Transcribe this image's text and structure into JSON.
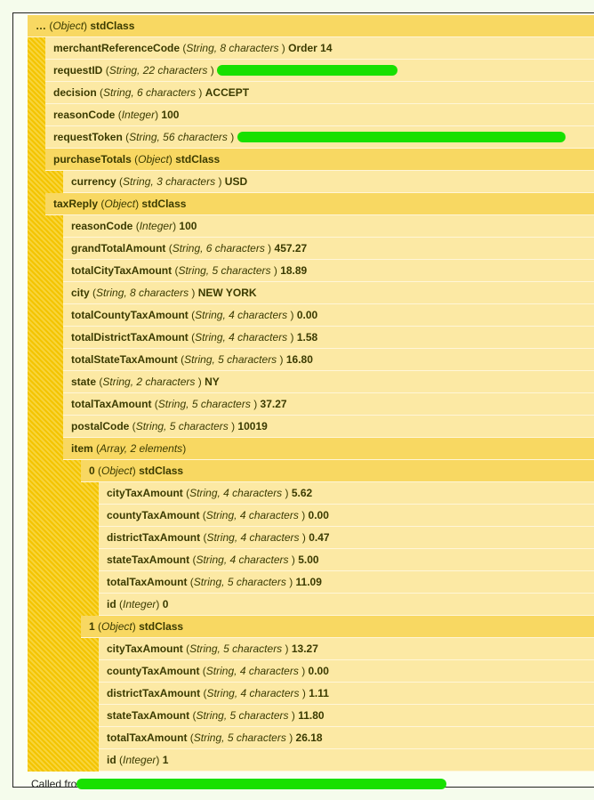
{
  "rows": [
    {
      "d": 0,
      "obj": true,
      "key": "…",
      "type": "Object",
      "value": "stdClass"
    },
    {
      "d": 1,
      "key": "merchantReferenceCode",
      "type": "String, 8 characters ",
      "value": "Order 14"
    },
    {
      "d": 1,
      "key": "requestID",
      "type": "String, 22 characters ",
      "value": "",
      "redacted": 203
    },
    {
      "d": 1,
      "key": "decision",
      "type": "String, 6 characters ",
      "value": "ACCEPT"
    },
    {
      "d": 1,
      "key": "reasonCode",
      "type": "Integer",
      "value": "100"
    },
    {
      "d": 1,
      "key": "requestToken",
      "type": "String, 56 characters ",
      "value": "",
      "redacted": 369
    },
    {
      "d": 1,
      "obj": true,
      "key": "purchaseTotals",
      "type": "Object",
      "value": "stdClass"
    },
    {
      "d": 2,
      "key": "currency",
      "type": "String, 3 characters ",
      "value": "USD"
    },
    {
      "d": 1,
      "obj": true,
      "key": "taxReply",
      "type": "Object",
      "value": "stdClass"
    },
    {
      "d": 2,
      "key": "reasonCode",
      "type": "Integer",
      "value": "100"
    },
    {
      "d": 2,
      "key": "grandTotalAmount",
      "type": "String, 6 characters ",
      "value": "457.27"
    },
    {
      "d": 2,
      "key": "totalCityTaxAmount",
      "type": "String, 5 characters ",
      "value": "18.89"
    },
    {
      "d": 2,
      "key": "city",
      "type": "String, 8 characters ",
      "value": "NEW YORK"
    },
    {
      "d": 2,
      "key": "totalCountyTaxAmount",
      "type": "String, 4 characters ",
      "value": "0.00"
    },
    {
      "d": 2,
      "key": "totalDistrictTaxAmount",
      "type": "String, 4 characters ",
      "value": "1.58"
    },
    {
      "d": 2,
      "key": "totalStateTaxAmount",
      "type": "String, 5 characters ",
      "value": "16.80"
    },
    {
      "d": 2,
      "key": "state",
      "type": "String, 2 characters ",
      "value": "NY"
    },
    {
      "d": 2,
      "key": "totalTaxAmount",
      "type": "String, 5 characters ",
      "value": "37.27"
    },
    {
      "d": 2,
      "key": "postalCode",
      "type": "String, 5 characters ",
      "value": "10019"
    },
    {
      "d": 2,
      "obj": true,
      "key": "item",
      "type": "Array, 2 elements",
      "value": ""
    },
    {
      "d": 3,
      "obj": true,
      "key": "0",
      "type": "Object",
      "value": "stdClass"
    },
    {
      "d": 4,
      "key": "cityTaxAmount",
      "type": "String, 4 characters ",
      "value": "5.62"
    },
    {
      "d": 4,
      "key": "countyTaxAmount",
      "type": "String, 4 characters ",
      "value": "0.00"
    },
    {
      "d": 4,
      "key": "districtTaxAmount",
      "type": "String, 4 characters ",
      "value": "0.47"
    },
    {
      "d": 4,
      "key": "stateTaxAmount",
      "type": "String, 4 characters ",
      "value": "5.00"
    },
    {
      "d": 4,
      "key": "totalTaxAmount",
      "type": "String, 5 characters ",
      "value": "11.09"
    },
    {
      "d": 4,
      "key": "id",
      "type": "Integer",
      "value": "0"
    },
    {
      "d": 3,
      "obj": true,
      "key": "1",
      "type": "Object",
      "value": "stdClass"
    },
    {
      "d": 4,
      "key": "cityTaxAmount",
      "type": "String, 5 characters ",
      "value": "13.27"
    },
    {
      "d": 4,
      "key": "countyTaxAmount",
      "type": "String, 4 characters ",
      "value": "0.00"
    },
    {
      "d": 4,
      "key": "districtTaxAmount",
      "type": "String, 4 characters ",
      "value": "1.11"
    },
    {
      "d": 4,
      "key": "stateTaxAmount",
      "type": "String, 5 characters ",
      "value": "11.80"
    },
    {
      "d": 4,
      "key": "totalTaxAmount",
      "type": "String, 5 characters ",
      "value": "26.18"
    },
    {
      "d": 4,
      "key": "id",
      "type": "Integer",
      "value": "1"
    }
  ],
  "footer": {
    "label": "Called fro"
  },
  "colors": {
    "hatch": "#f3c400",
    "object_row": "#f8d862",
    "row": "#fce9a4",
    "text": "#3b3b00",
    "redaction": "#18e000"
  }
}
